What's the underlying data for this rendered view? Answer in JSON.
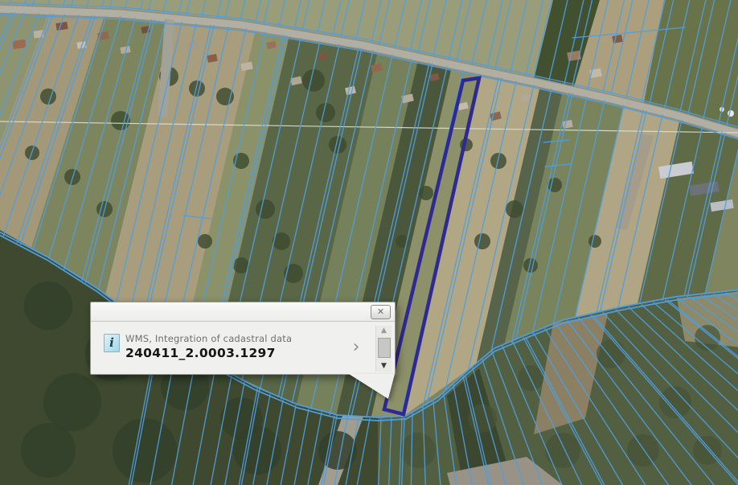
{
  "popup": {
    "source_line": "WMS, Integration of cadastral data",
    "feature_id": "240411_2.0003.1297"
  },
  "icons": {
    "info_glyph": "i",
    "chevron_glyph": "›",
    "close_glyph": "✕",
    "scroll_up_glyph": "▲",
    "scroll_down_glyph": "▼"
  },
  "map": {
    "cadastral_line_color": "#4f9fe0",
    "selected_parcel_color": "#2f2a92"
  }
}
